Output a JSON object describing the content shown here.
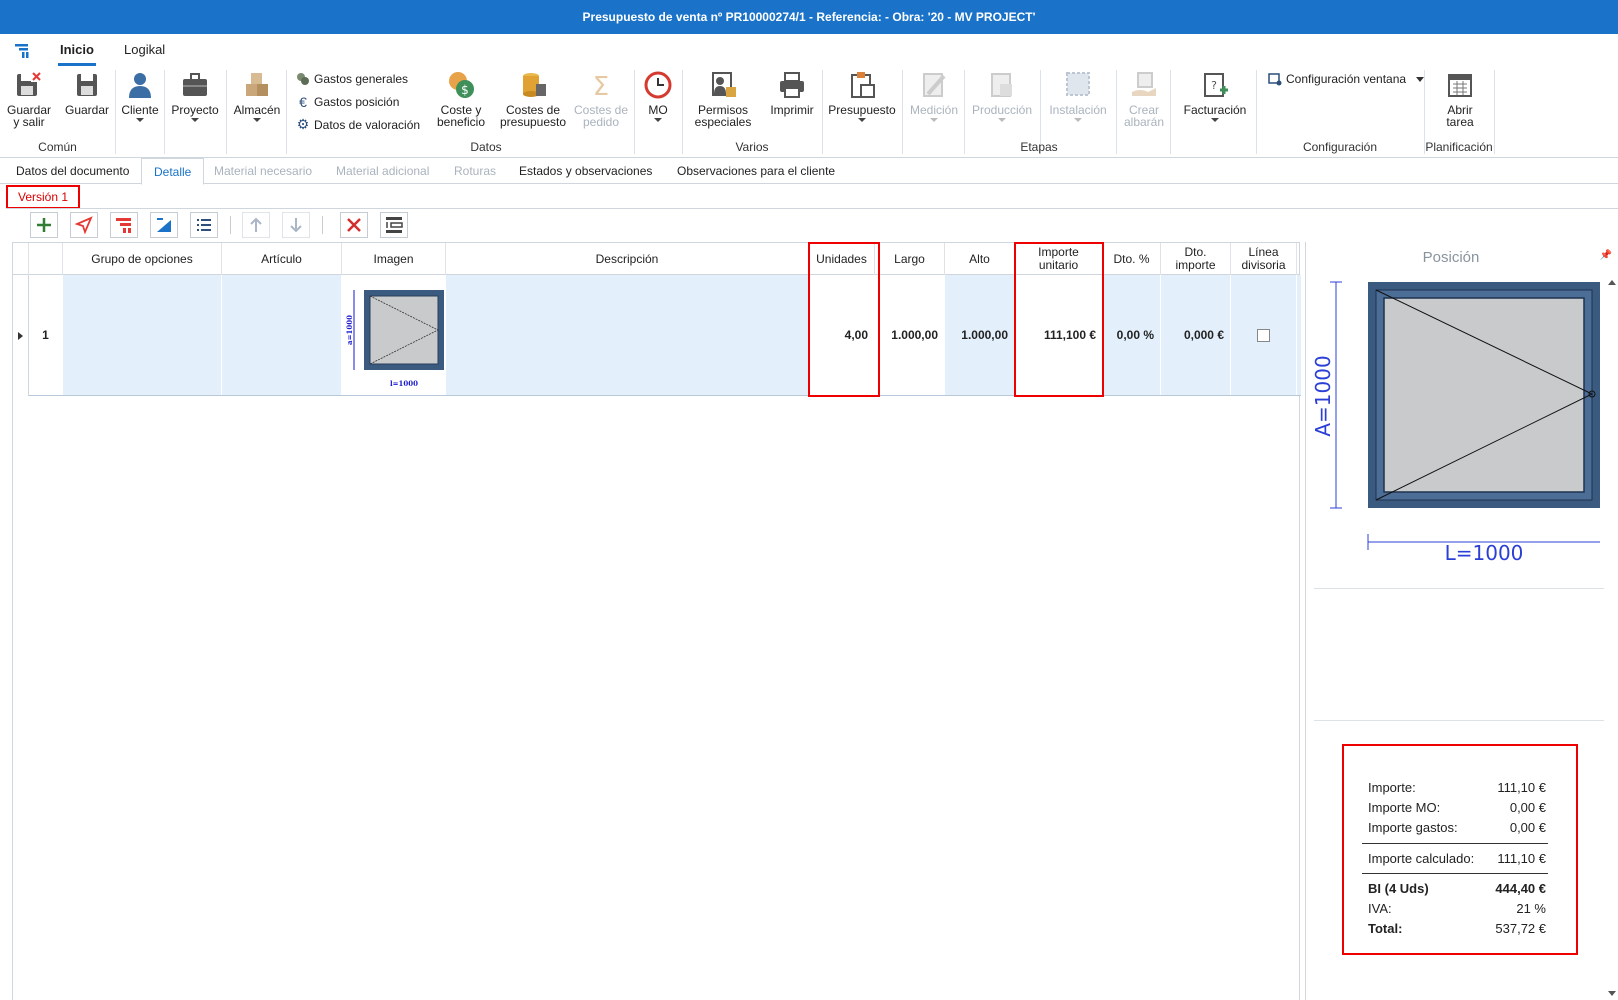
{
  "window": {
    "title": "Presupuesto de venta nº PR10000274/1 - Referencia:  - Obra: '20 - MV PROJECT'"
  },
  "menu": {
    "tabs": [
      "Inicio",
      "Logikal"
    ]
  },
  "ribbon": {
    "buttons": {
      "guardar_salir": "Guardar y salir",
      "guardar": "Guardar",
      "cliente": "Cliente",
      "proyecto": "Proyecto",
      "almacen": "Almacén",
      "coste_beneficio": "Coste y beneficio",
      "costes_presupuesto": "Costes de presupuesto",
      "costes_pedido": "Costes de pedido",
      "mo": "MO",
      "permisos_especiales": "Permisos especiales",
      "imprimir": "Imprimir",
      "presupuesto": "Presupuesto",
      "medicion": "Medición",
      "produccion": "Producción",
      "instalacion": "Instalación",
      "crear_albaran": "Crear albarán",
      "facturacion": "Facturación",
      "configuracion_ventana": "Configuración ventana",
      "abrir_tarea": "Abrir tarea"
    },
    "small_items": [
      "Gastos generales",
      "Gastos posición",
      "Datos de valoración"
    ],
    "groups": [
      "Común",
      "Datos",
      "Varios",
      "Etapas",
      "Configuración",
      "Planificación"
    ]
  },
  "doc_tabs": [
    "Datos del documento",
    "Detalle",
    "Material necesario",
    "Material adicional",
    "Roturas",
    "Estados y observaciones",
    "Observaciones para el cliente"
  ],
  "version_tab": "Versión 1",
  "grid": {
    "columns": [
      "Grupo de opciones",
      "Artículo",
      "Imagen",
      "Descripción",
      "Unidades",
      "Largo",
      "Alto",
      "Importe unitario",
      "Dto. %",
      "Dto. importe",
      "Línea divisoria"
    ],
    "rows": [
      {
        "num": "1",
        "grupo": "",
        "articulo": "",
        "descripcion": "",
        "unidades": "4,00",
        "largo": "1.000,00",
        "alto": "1.000,00",
        "importe_unitario": "111,100 €",
        "dto_pct": "0,00 %",
        "dto_importe": "0,000 €",
        "linea_divisoria": false,
        "thumb_height_label": "a=1000",
        "thumb_width_label": "l=1000"
      }
    ]
  },
  "side_panel": {
    "title": "Posición",
    "drawing": {
      "height_label": "A=1000",
      "width_label": "L=1000"
    }
  },
  "summary": {
    "importe": {
      "label": "Importe:",
      "value": "111,10 €"
    },
    "importe_mo": {
      "label": "Importe MO:",
      "value": "0,00 €"
    },
    "importe_gastos": {
      "label": "Importe gastos:",
      "value": "0,00 €"
    },
    "importe_calculado": {
      "label": "Importe calculado:",
      "value": "111,10 €"
    },
    "bi": {
      "label": "BI (4 Uds)",
      "value": "444,40 €"
    },
    "iva": {
      "label": "IVA:",
      "value": "21 %"
    },
    "total": {
      "label": "Total:",
      "value": "537,72 €"
    }
  },
  "colors": {
    "accent": "#1a73c8",
    "highlight": "#e00000",
    "row_selected": "#e3f0fc",
    "frame": "#3b5a80",
    "glass": "#c8cacc"
  }
}
